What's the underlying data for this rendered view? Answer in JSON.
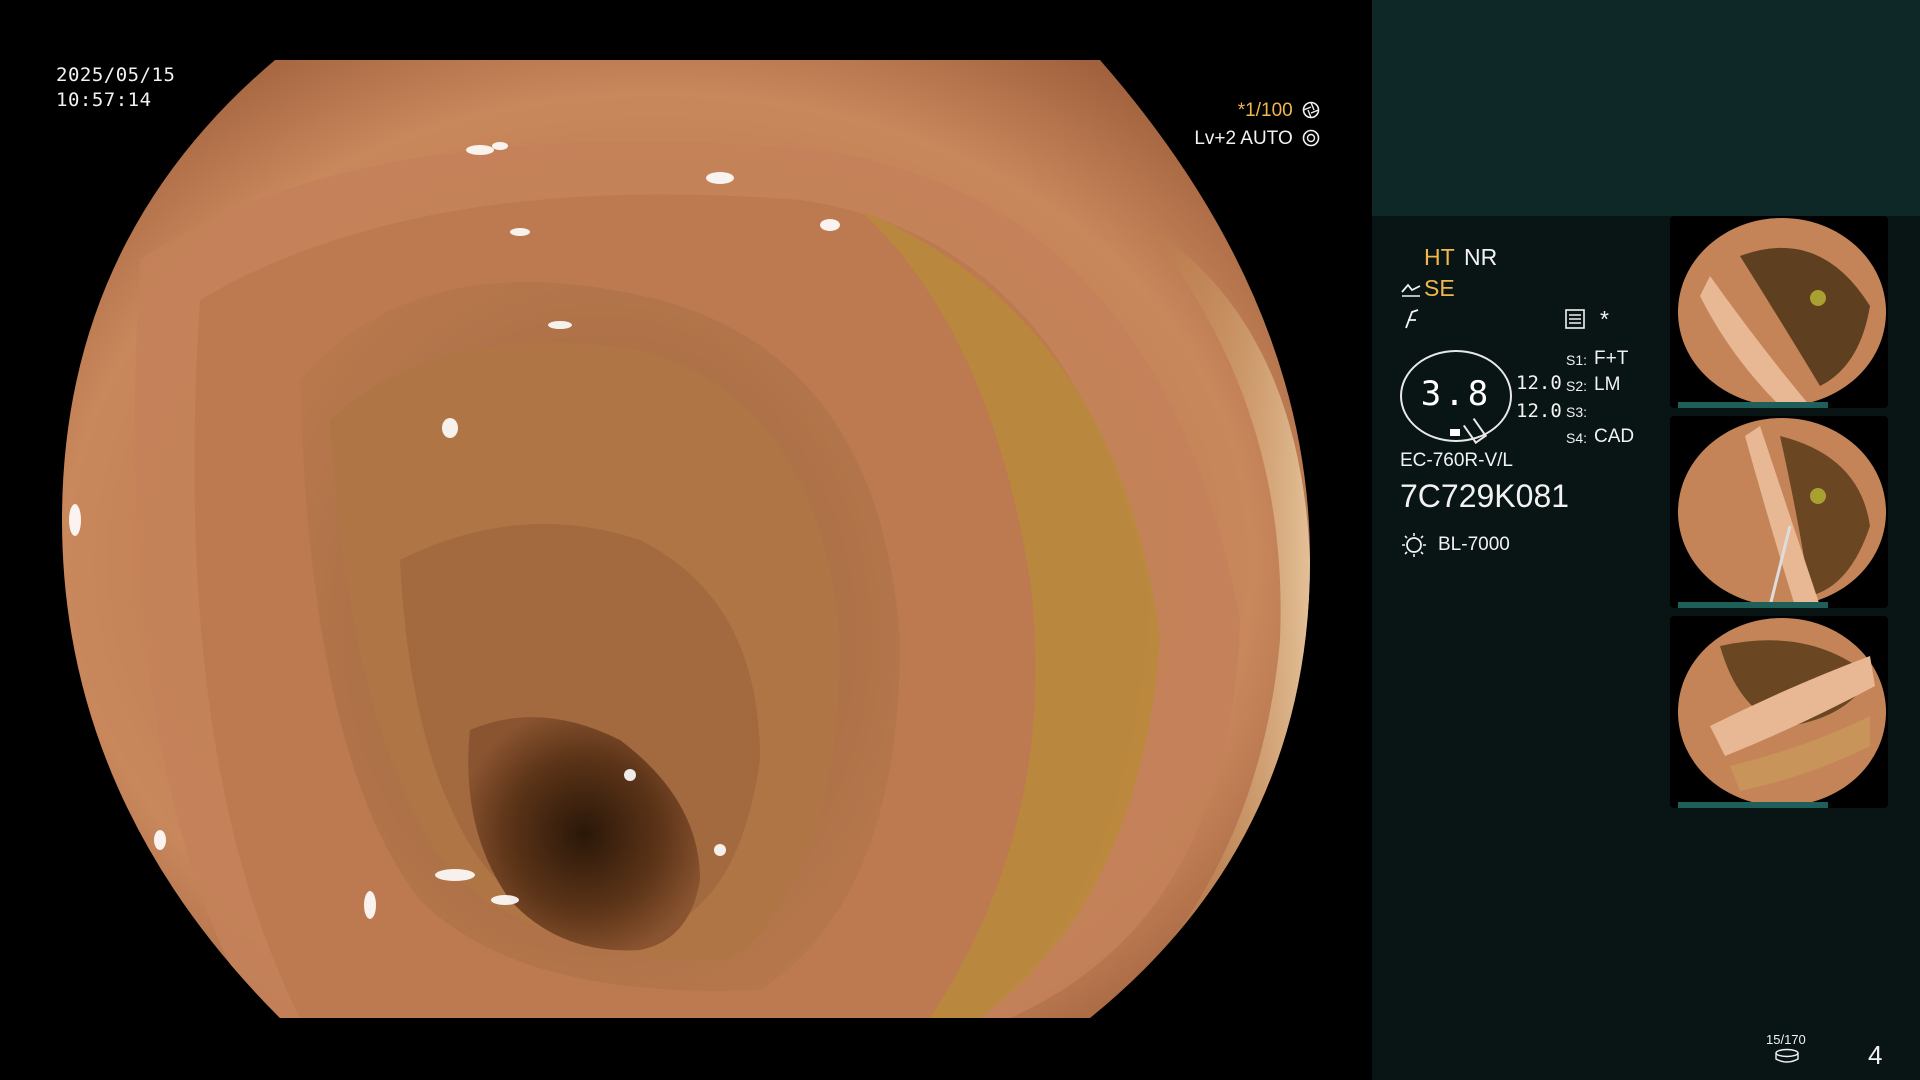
{
  "overlay": {
    "date": "2025/05/15",
    "time": "10:57:14",
    "shutter": "*1/100",
    "shutter_icon": "aperture-icon",
    "level": "Lv+2",
    "mode": "AUTO",
    "mode_icon": "target-icon"
  },
  "settings": {
    "ht": "HT",
    "nr": "NR",
    "se": "SE",
    "se_icon": "structure-enhance-icon",
    "color_icon": "color-tone-icon",
    "menu_icon": "settings-list-icon",
    "asterisk": "*",
    "zoom": "3.8",
    "value_1": "12.0",
    "value_2": "12.0",
    "s1_label": "S1:",
    "s1_value": "F+T",
    "s2_label": "S2:",
    "s2_value": "LM",
    "s3_label": "S3:",
    "s3_value": "",
    "s4_label": "S4:",
    "s4_value": "CAD",
    "scope_model": "EC-760R-V/L",
    "scope_serial": "7C729K081",
    "light_source": "BL-7000",
    "light_icon": "light-source-icon"
  },
  "thumbnails": [
    {
      "name": "captured-image-1"
    },
    {
      "name": "captured-image-2"
    },
    {
      "name": "captured-image-3"
    }
  ],
  "footer": {
    "storage_counter": "15/170",
    "storage_icon": "storage-disk-icon",
    "page_number": "4"
  },
  "colors": {
    "accent_yellow": "#f0b84a",
    "panel_bg": "#081514",
    "panel_top": "#0d2826",
    "thumb_bar": "#1e5f5a",
    "mucosa": "#c8845a"
  }
}
